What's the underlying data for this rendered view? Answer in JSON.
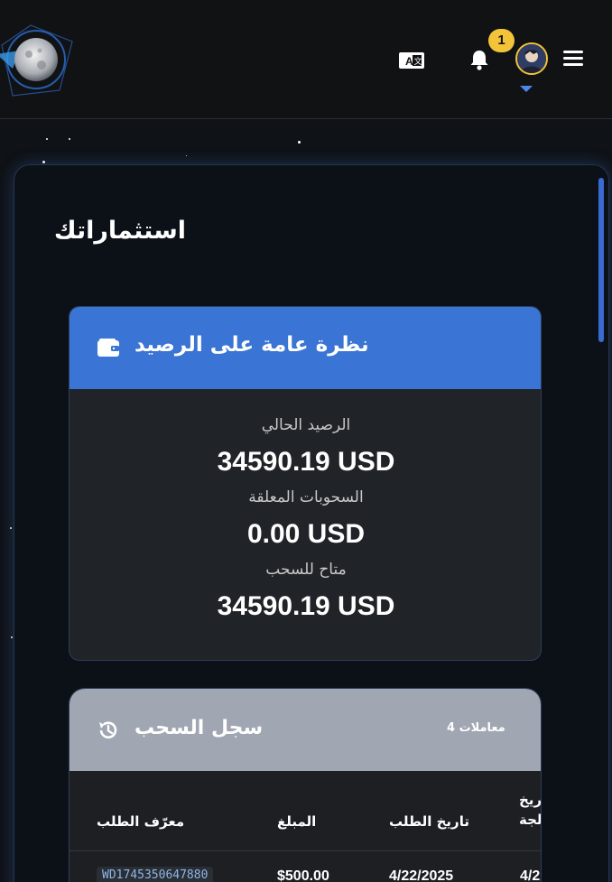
{
  "header": {
    "notification_count": "1",
    "icons": [
      "moon-logo-icon",
      "translate-icon",
      "bell-icon",
      "avatar",
      "menu-icon"
    ]
  },
  "page": {
    "title": "استثماراتك"
  },
  "balance": {
    "title": "نظرة عامة على الرصيد",
    "current_label": "الرصيد الحالي",
    "current_value": "34590.19 USD",
    "pending_label": "السحوبات المعلقة",
    "pending_value": "0.00 USD",
    "available_label": "متاح للسحب",
    "available_value": "34590.19 USD"
  },
  "history": {
    "title": "سجل السحب",
    "count_label": "معاملات 4",
    "columns": [
      "معرّف الطلب",
      "المبلغ",
      "تاريخ الطلب",
      "ريخ\nلجة"
    ],
    "rows": [
      [
        "WD1745350647880",
        "$500.00",
        "4/22/2025",
        "4/2"
      ]
    ]
  },
  "colors": {
    "balance_header": "#3a74d4",
    "history_header": "#a0a6b2",
    "badge": "#f3c43a",
    "accent": "#4b86e8"
  }
}
